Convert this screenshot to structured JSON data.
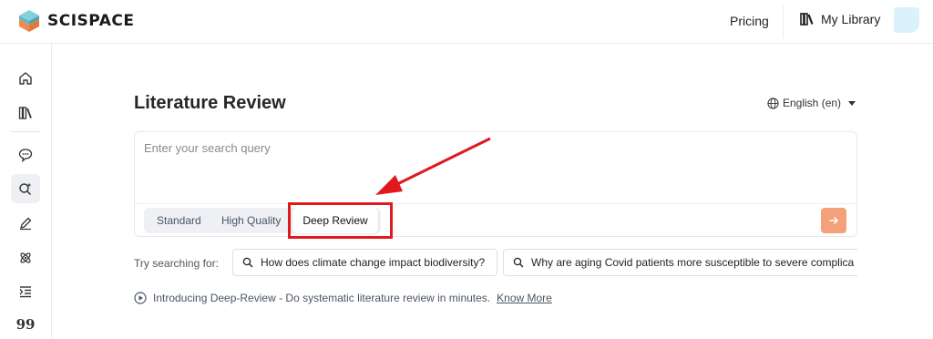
{
  "header": {
    "brand": "SCISPACE",
    "pricing_label": "Pricing",
    "library_label": "My Library",
    "logo_colors": {
      "top": "#7fd1dc",
      "bottom": "#f08a4b"
    }
  },
  "sidebar": {
    "items": [
      {
        "name": "home",
        "icon": "home-icon"
      },
      {
        "name": "library",
        "icon": "books-icon"
      },
      {
        "name": "chat",
        "icon": "chat-icon"
      },
      {
        "name": "literature-review",
        "icon": "search-sparkle-icon",
        "active": true
      },
      {
        "name": "ai-writer",
        "icon": "pen-icon"
      },
      {
        "name": "extract",
        "icon": "atom-icon"
      },
      {
        "name": "paraphraser",
        "icon": "indent-list-icon"
      },
      {
        "name": "citation",
        "icon": "quote-icon",
        "glyph": "99"
      }
    ]
  },
  "main": {
    "title": "Literature Review",
    "language": "English (en)",
    "search": {
      "placeholder": "Enter your search query",
      "value": ""
    },
    "modes": {
      "standard": "Standard",
      "high_quality": "High Quality",
      "deep_review": "Deep Review",
      "selected": "Deep Review"
    },
    "try_label": "Try searching for:",
    "suggestions": [
      "How does climate change impact biodiversity?",
      "Why are aging Covid patients more susceptible to severe complica"
    ],
    "intro_text": "Introducing Deep-Review - Do systematic literature review in minutes.",
    "intro_link": "Know More"
  },
  "colors": {
    "accent": "#f4a07a",
    "annotation_red": "#e0191f",
    "avatar": "#d9f2fb"
  }
}
